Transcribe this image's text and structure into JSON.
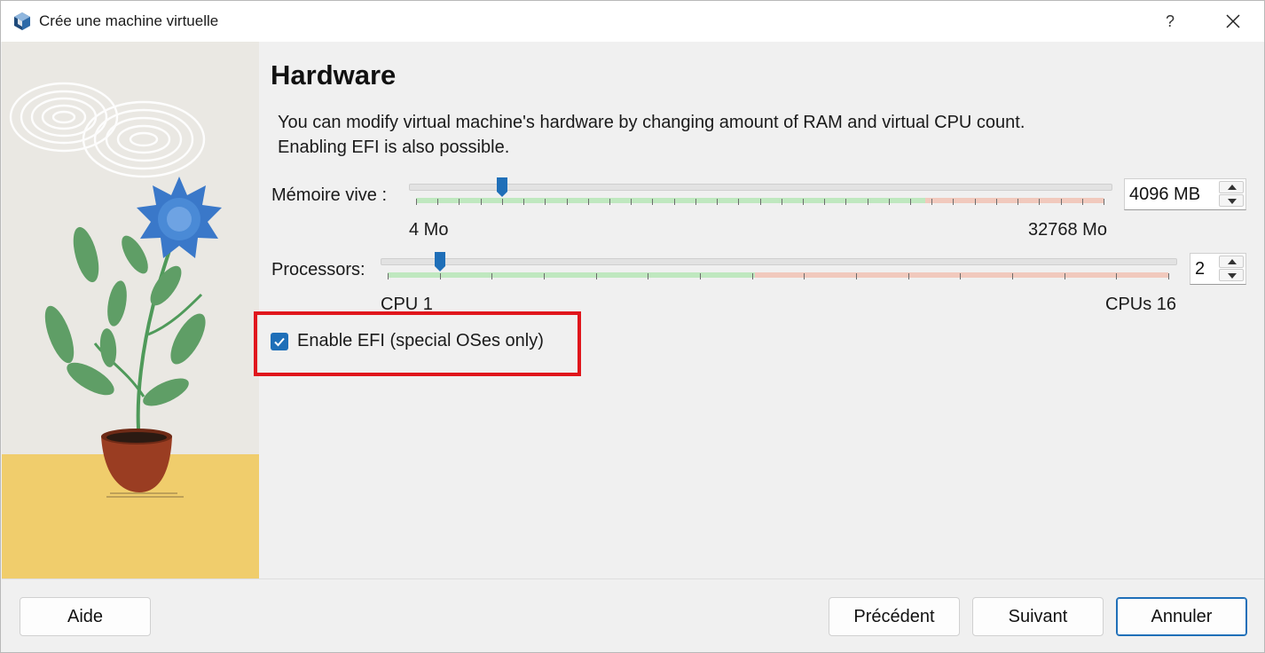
{
  "window": {
    "title": "Crée une machine virtuelle",
    "help_label": "?",
    "icon": "virtualbox-cube-icon"
  },
  "page": {
    "heading": "Hardware",
    "description_line1": "You can modify virtual machine's hardware by changing amount of RAM and virtual CPU count.",
    "description_line2": "Enabling EFI is also possible."
  },
  "memory": {
    "label": "Mémoire vive :",
    "value": "4096 MB",
    "value_mb": 4096,
    "min_label": "4 Mo",
    "max_label": "32768 Mo",
    "min_mb": 4,
    "max_mb": 32768,
    "recommended_fraction": 0.74
  },
  "processors": {
    "label": "Processors:",
    "value": "2",
    "value_count": 2,
    "min_label": "CPU 1",
    "max_label": "CPUs 16",
    "min": 1,
    "max": 16,
    "recommended_fraction": 0.47
  },
  "efi": {
    "label": "Enable EFI (special OSes only)",
    "checked": true
  },
  "buttons": {
    "help": "Aide",
    "previous": "Précédent",
    "next": "Suivant",
    "cancel": "Annuler"
  },
  "colors": {
    "accent": "#1f6fb8",
    "slider_ok": "#bfe8bf",
    "slider_warn": "#f1c9bd",
    "slider_bad": "#f0b3b3",
    "highlight": "#e0161c"
  }
}
